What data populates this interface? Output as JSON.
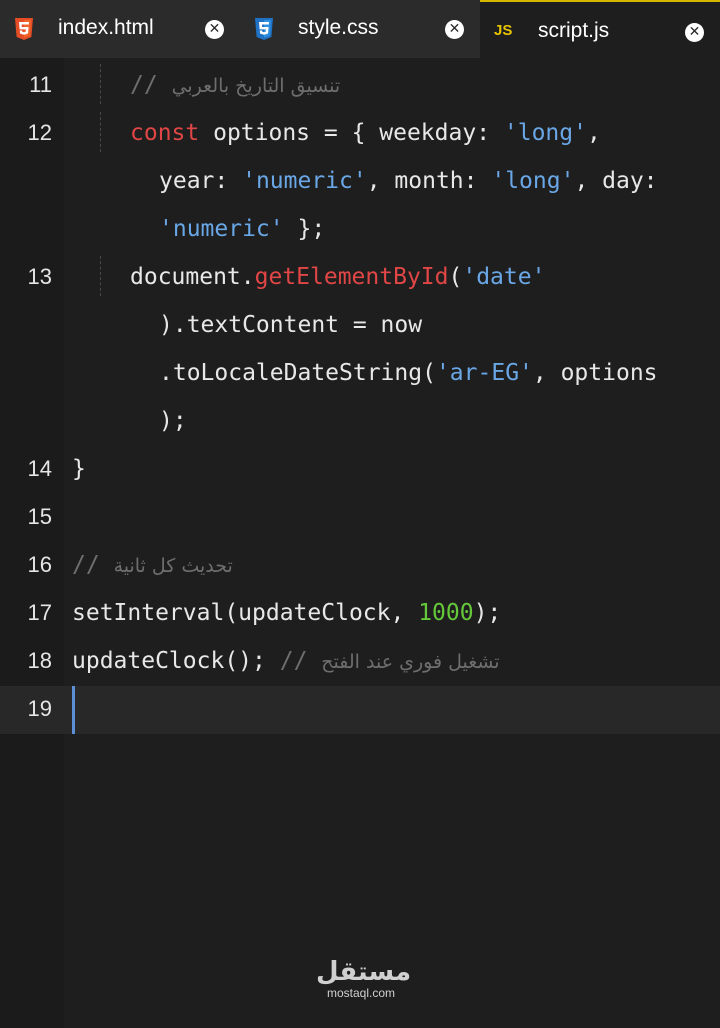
{
  "tabs": [
    {
      "label": "index.html",
      "icon": "html5-icon",
      "active": false
    },
    {
      "label": "style.css",
      "icon": "css3-icon",
      "active": false
    },
    {
      "label": "script.js",
      "icon": "js-icon",
      "icon_text": "JS",
      "active": true
    }
  ],
  "tab_close_glyph": "✕",
  "line_numbers": [
    "11",
    "12",
    "13",
    "14",
    "15",
    "16",
    "17",
    "18",
    "19"
  ],
  "code": {
    "l11_comment_ar": "تنسيق التاريخ بالعربي",
    "l11_comment_slash": "//",
    "l12_kw": "const",
    "l12_a": " options = { weekday: ",
    "l12_s1": "'long'",
    "l12_b": ",",
    "l12w_a": "year: ",
    "l12w_s2": "'numeric'",
    "l12w_b": ", month: ",
    "l12w_s3": "'long'",
    "l12w_c": ", day:",
    "l12w2_s4": "'numeric'",
    "l12w2_a": " };",
    "l13_a": "document.",
    "l13_fn": "getElementById",
    "l13_b": "(",
    "l13_s": "'date'",
    "l13w_a": ").textContent = now",
    "l13w2_a": ".toLocaleDateString(",
    "l13w2_s": "'ar-EG'",
    "l13w2_b": ", options",
    "l13w3_a": ");",
    "l14": "}",
    "l16_slash": "//",
    "l16_ar": "تحديث كل ثانية",
    "l17_a": "setInterval(updateClock, ",
    "l17_num": "1000",
    "l17_b": ");",
    "l18_a": "updateClock(); ",
    "l18_slash": "//",
    "l18_ar": "تشغيل فوري عند الفتح"
  },
  "watermark": {
    "arabic": "مستقل",
    "latin": "mostaql.com"
  },
  "colors": {
    "keyword": "#e04646",
    "string": "#6aa7e6",
    "number": "#64c83a",
    "comment": "#6e6e6e",
    "active_tab_accent": "#d7b600"
  }
}
